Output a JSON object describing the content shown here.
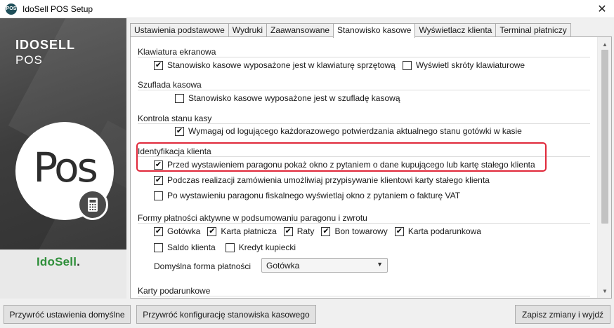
{
  "window": {
    "title": "IdoSell POS Setup",
    "app_icon_text": "POS",
    "close_glyph": "✕"
  },
  "brand": {
    "name": "IDOSELL",
    "sub": "POS",
    "pos_big": "Pos",
    "logo_ido": "IdoSell",
    "logo_dot": "."
  },
  "tabs": [
    {
      "label": "Ustawienia podstawowe"
    },
    {
      "label": "Wydruki"
    },
    {
      "label": "Zaawansowane"
    },
    {
      "label": "Stanowisko kasowe"
    },
    {
      "label": "Wyświetlacz klienta"
    },
    {
      "label": "Terminal płatniczy"
    }
  ],
  "active_tab": "Stanowisko kasowe",
  "sections": {
    "klawiatura": {
      "title": "Klawiatura ekranowa",
      "opt1": {
        "label": "Stanowisko kasowe wyposażone jest w klawiaturę sprzętową",
        "checked": true
      },
      "opt2": {
        "label": "Wyświetl skróty klawiaturowe",
        "checked": false
      }
    },
    "szuflada": {
      "title": "Szuflada kasowa",
      "opt1": {
        "label": "Stanowisko kasowe wyposażone jest w szufladę kasową",
        "checked": false
      }
    },
    "kontrola": {
      "title": "Kontrola stanu kasy",
      "opt1": {
        "label": "Wymagaj od logującego każdorazowego potwierdzania aktualnego stanu gotówki w kasie",
        "checked": true
      }
    },
    "identyfikacja": {
      "title": "Identyfikacja klienta",
      "opt1": {
        "label": "Przed wystawieniem paragonu pokaż okno z pytaniem o dane kupującego lub kartę stałego klienta",
        "checked": true
      },
      "opt2": {
        "label": "Podczas realizacji zamówienia umożliwiaj przypisywanie klientowi karty stałego klienta",
        "checked": true
      },
      "opt3": {
        "label": "Po wystawieniu paragonu fiskalnego wyświetlaj okno z pytaniem o fakturę VAT",
        "checked": false
      }
    },
    "formy": {
      "title": "Formy płatności aktywne w podsumowaniu paragonu i zwrotu",
      "gotowka": {
        "label": "Gotówka",
        "checked": true
      },
      "karta": {
        "label": "Karta płatnicza",
        "checked": true
      },
      "raty": {
        "label": "Raty",
        "checked": true
      },
      "bon": {
        "label": "Bon towarowy",
        "checked": true
      },
      "podarunkowa": {
        "label": "Karta podarunkowa",
        "checked": true
      },
      "saldo": {
        "label": "Saldo klienta",
        "checked": false
      },
      "kredyt": {
        "label": "Kredyt kupiecki",
        "checked": false
      },
      "default_label": "Domyślna forma płatności",
      "default_value": "Gotówka"
    },
    "karty": {
      "title": "Karty podarunkowe"
    }
  },
  "buttons": {
    "restore_defaults": "Przywróć ustawienia domyślne",
    "restore_station": "Przywróć konfigurację stanowiska kasowego",
    "save_exit": "Zapisz zmiany i wyjdź"
  },
  "colors": {
    "highlight": "#e0283a",
    "brand_green": "#2f8f3a"
  }
}
